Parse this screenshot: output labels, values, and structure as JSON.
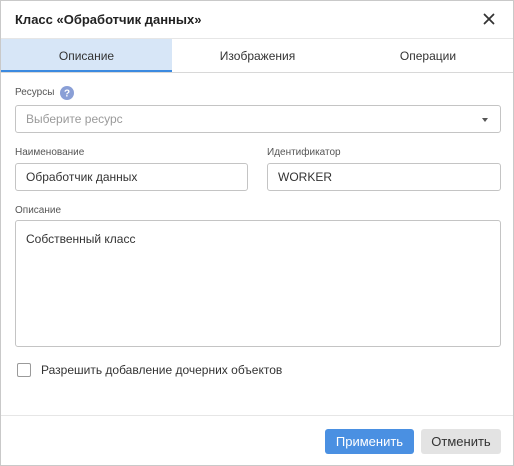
{
  "dialog": {
    "title": "Класс «Обработчик данных»",
    "close_icon": "close-icon"
  },
  "tabs": [
    {
      "label": "Описание",
      "active": true
    },
    {
      "label": "Изображения",
      "active": false
    },
    {
      "label": "Операции",
      "active": false
    }
  ],
  "form": {
    "resources": {
      "label": "Ресурсы",
      "help_icon": "question-circle-icon",
      "placeholder": "Выберите ресурс",
      "value": ""
    },
    "name": {
      "label": "Наименование",
      "value": "Обработчик данных"
    },
    "identifier": {
      "label": "Идентификатор",
      "value": "WORKER"
    },
    "description": {
      "label": "Описание",
      "value": "Собственный класс"
    },
    "allow_children": {
      "label": "Разрешить добавление дочерних объектов",
      "checked": false
    }
  },
  "footer": {
    "apply_label": "Применить",
    "cancel_label": "Отменить"
  },
  "colors": {
    "accent": "#4a90e2",
    "active_tab_bg": "#d7e6f7",
    "help_icon": "#8a9fd6"
  }
}
